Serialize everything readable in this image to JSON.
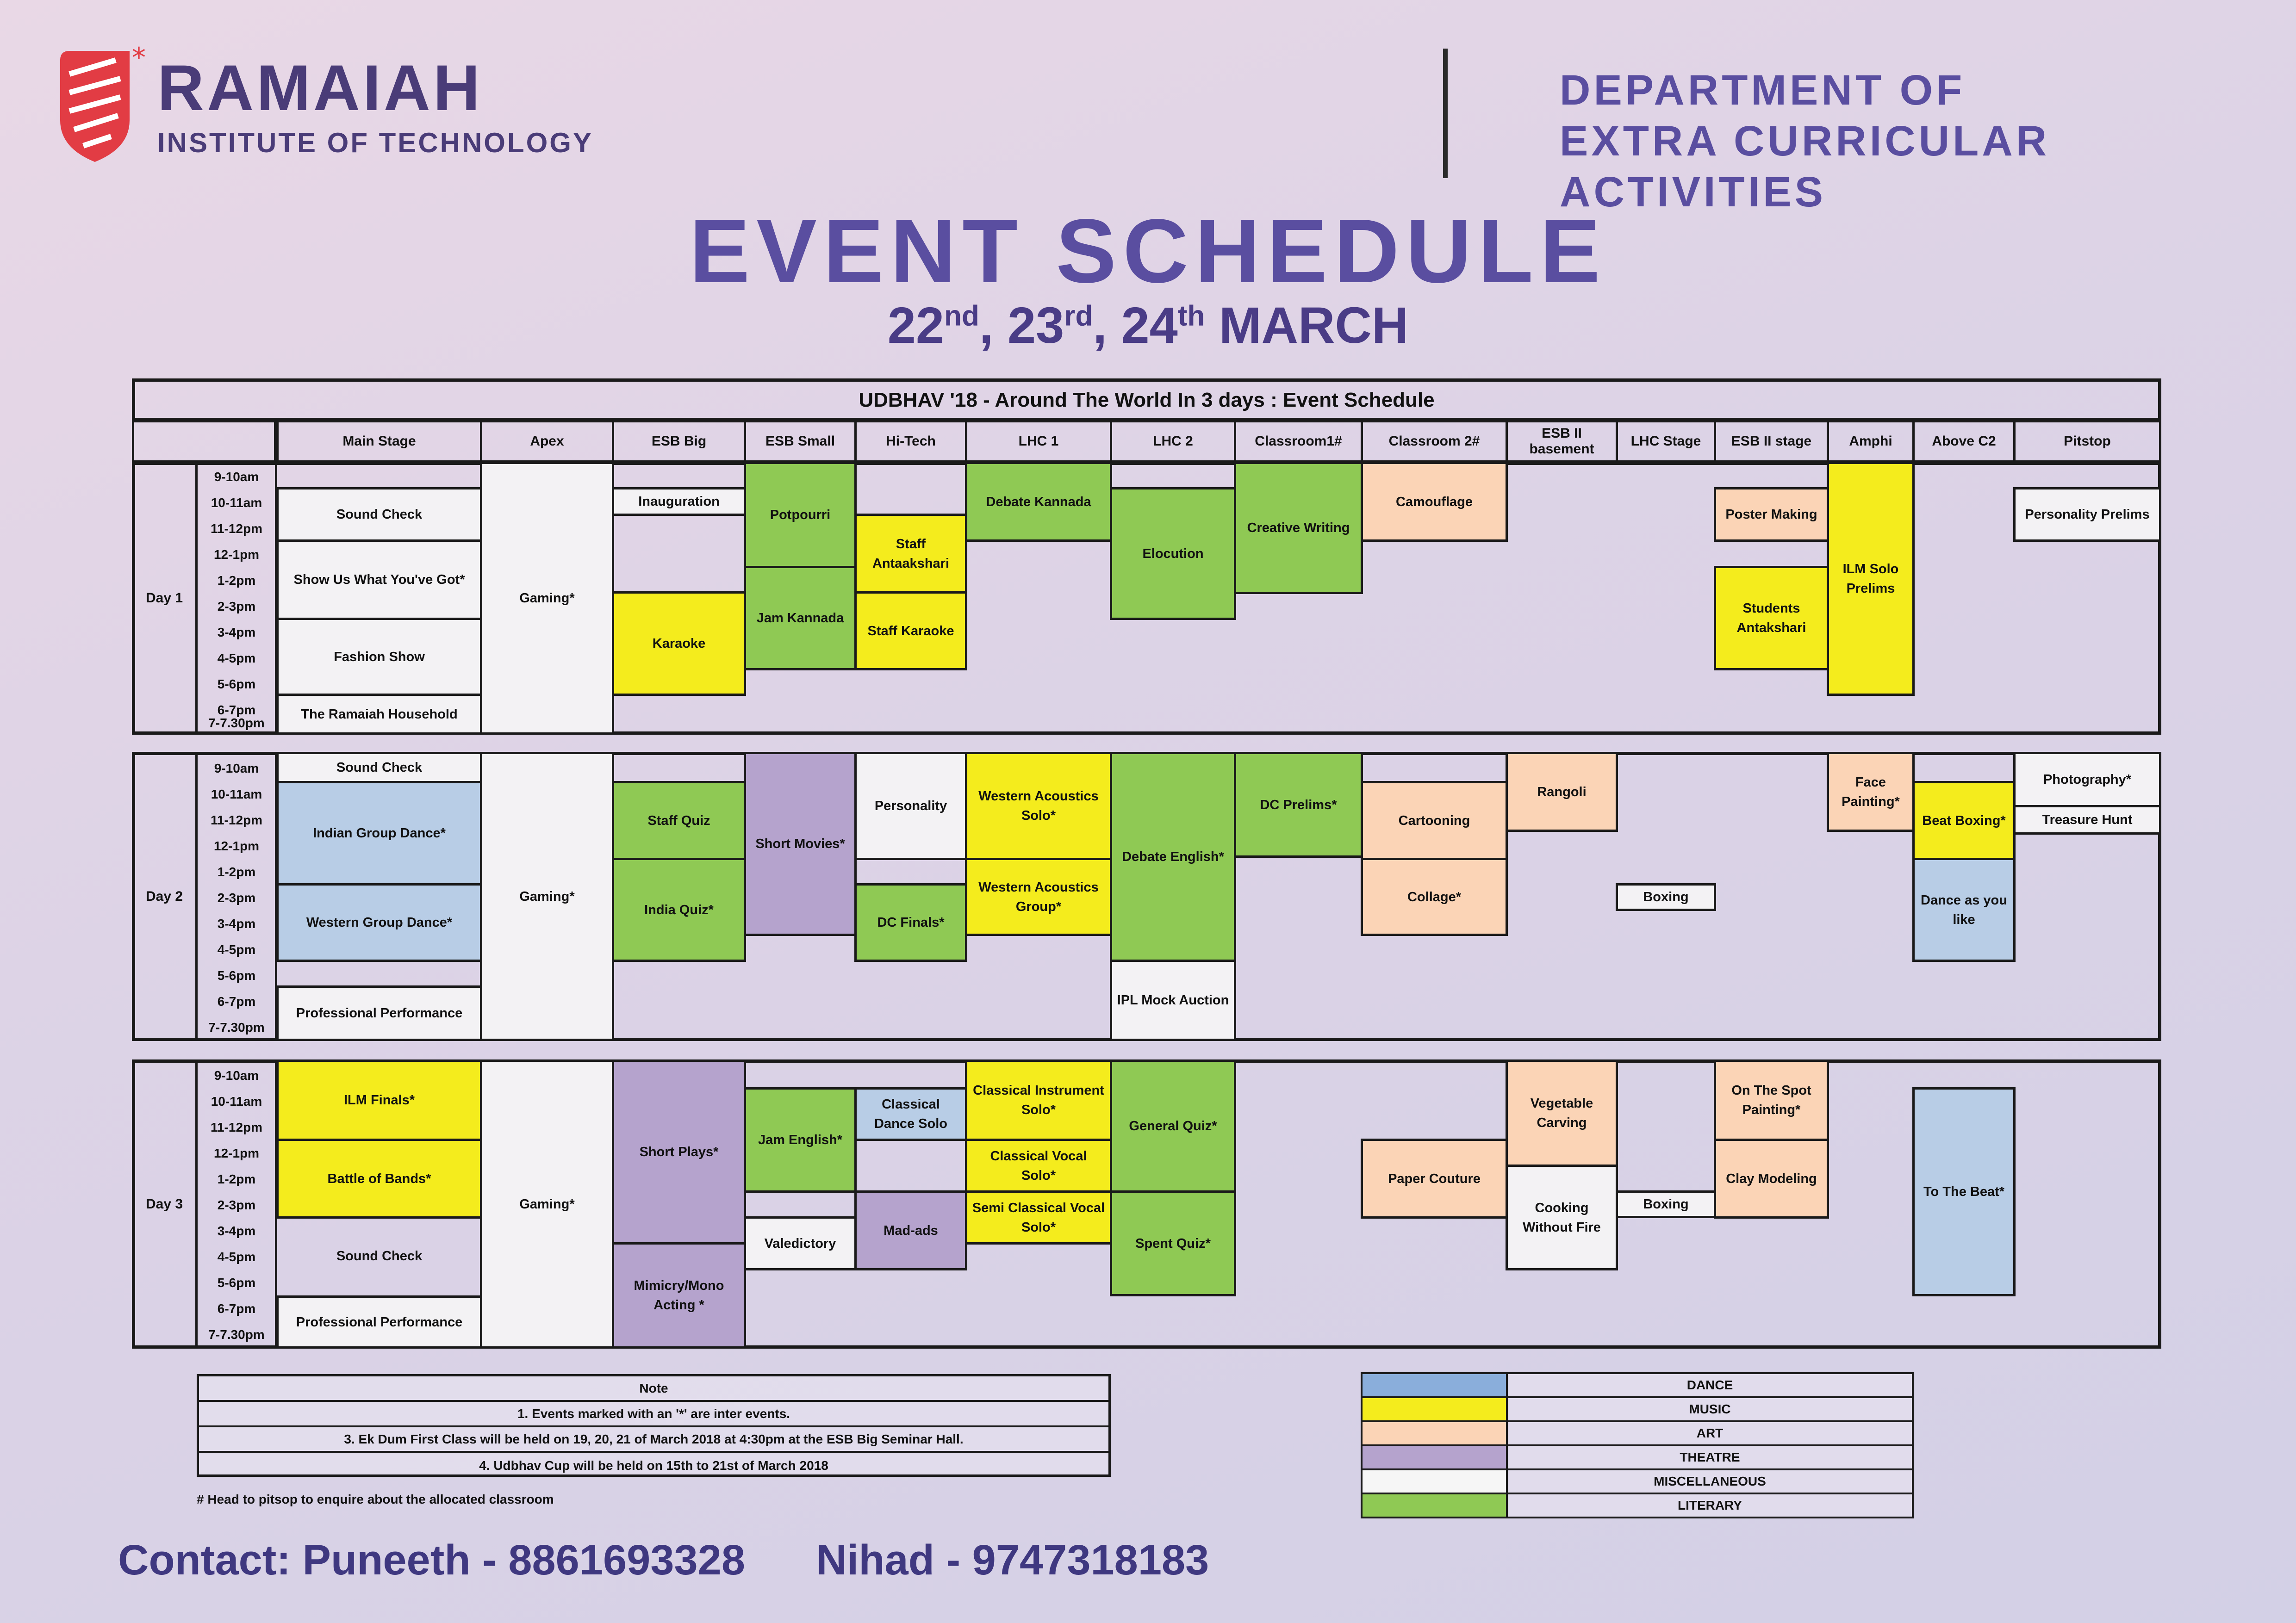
{
  "header": {
    "logo_name": "RAMAIAH",
    "logo_sub": "INSTITUTE OF TECHNOLOGY",
    "dept_line1": "DEPARTMENT OF",
    "dept_line2": "EXTRA CURRICULAR ACTIVITIES"
  },
  "title": "EVENT SCHEDULE",
  "dates": {
    "d1": "22",
    "s1": "nd",
    "d2": "23",
    "s2": "rd",
    "d3": "24",
    "s3": "th",
    "month": "MARCH"
  },
  "schedule_title": "UDBHAV '18 - Around The World In 3 days  : Event Schedule",
  "columns": [
    "Main Stage",
    "Apex",
    "ESB Big",
    "ESB Small",
    "Hi-Tech",
    "LHC 1",
    "LHC 2",
    "Classroom1#",
    "Classroom 2#",
    "ESB II basement",
    "LHC Stage",
    "ESB II stage",
    "Amphi",
    "Above C2",
    "Pitstop"
  ],
  "times": [
    "9-10am",
    "10-11am",
    "11-12pm",
    "12-1pm",
    "1-2pm",
    "2-3pm",
    "3-4pm",
    "4-5pm",
    "5-6pm",
    "6-7pm",
    "7-7.30pm"
  ],
  "days": [
    "Day 1",
    "Day 2",
    "Day 3"
  ],
  "events": {
    "d1": [
      "Sound Check",
      "Show Us What You've Got*",
      "Fashion Show",
      "The Ramaiah Household",
      "Gaming*",
      "Inauguration",
      "Karaoke",
      "Potpourri",
      "Jam Kannada",
      "Staff Antaakshari",
      "Staff Karaoke",
      "Debate  Kannada",
      "Elocution",
      "Creative Writing",
      "Camouflage",
      "Poster Making",
      "Students Antakshari",
      "ILM Solo Prelims",
      "Personality Prelims"
    ],
    "d2": [
      "Sound Check",
      "Indian Group Dance*",
      "Western Group Dance*",
      "Professional Performance",
      "Gaming*",
      "Staff Quiz",
      "India Quiz*",
      "Short  Movies*",
      "Personality",
      "DC Finals*",
      "Western Acoustics Solo*",
      "Western Acoustics Group*",
      "Debate English*",
      "IPL Mock Auction",
      "DC Prelims*",
      "Cartooning",
      "Collage*",
      "Rangoli",
      "Boxing",
      "Face Painting*",
      "Beat Boxing*",
      "Dance as you like",
      "Photography*",
      "Treasure Hunt"
    ],
    "d3": [
      "ILM Finals*",
      "Battle of Bands*",
      "Sound Check",
      "Professional Performance",
      "Gaming*",
      "Short Plays*",
      "Mimicry/Mono Acting *",
      "Jam English*",
      "Valedictory",
      "Classical Dance Solo",
      "Mad-ads",
      "Classical Instrument Solo*",
      "Classical Vocal Solo*",
      "Semi Classical Vocal Solo*",
      "General Quiz*",
      "Spent Quiz*",
      "Paper Couture",
      "Vegetable Carving",
      "Cooking Without Fire",
      "Boxing",
      "On The Spot Painting*",
      "Clay Modeling",
      "To The Beat*"
    ]
  },
  "notes": {
    "heading": "Note",
    "n1": "1. Events marked with an '*' are inter events.",
    "n3": "3. Ek Dum First Class will be held on 19, 20, 21 of March 2018 at 4:30pm at the ESB Big Seminar Hall.",
    "n4": "4. Udbhav Cup will be held on 15th to 21st of March 2018",
    "footnote": "# Head to pitsop to enquire about the allocated classroom"
  },
  "legend": [
    {
      "label": "DANCE",
      "color": "#8aaedb"
    },
    {
      "label": "MUSIC",
      "color": "#f4ec1d"
    },
    {
      "label": "ART",
      "color": "#fbd4b6"
    },
    {
      "label": "THEATRE",
      "color": "#b5a3cd"
    },
    {
      "label": "MISCELLANEOUS",
      "color": "#f6f6f6"
    },
    {
      "label": "LITERARY",
      "color": "#8fc954"
    }
  ],
  "contact": "Contact: Puneeth - 8861693328      Nihad - 9747318183"
}
